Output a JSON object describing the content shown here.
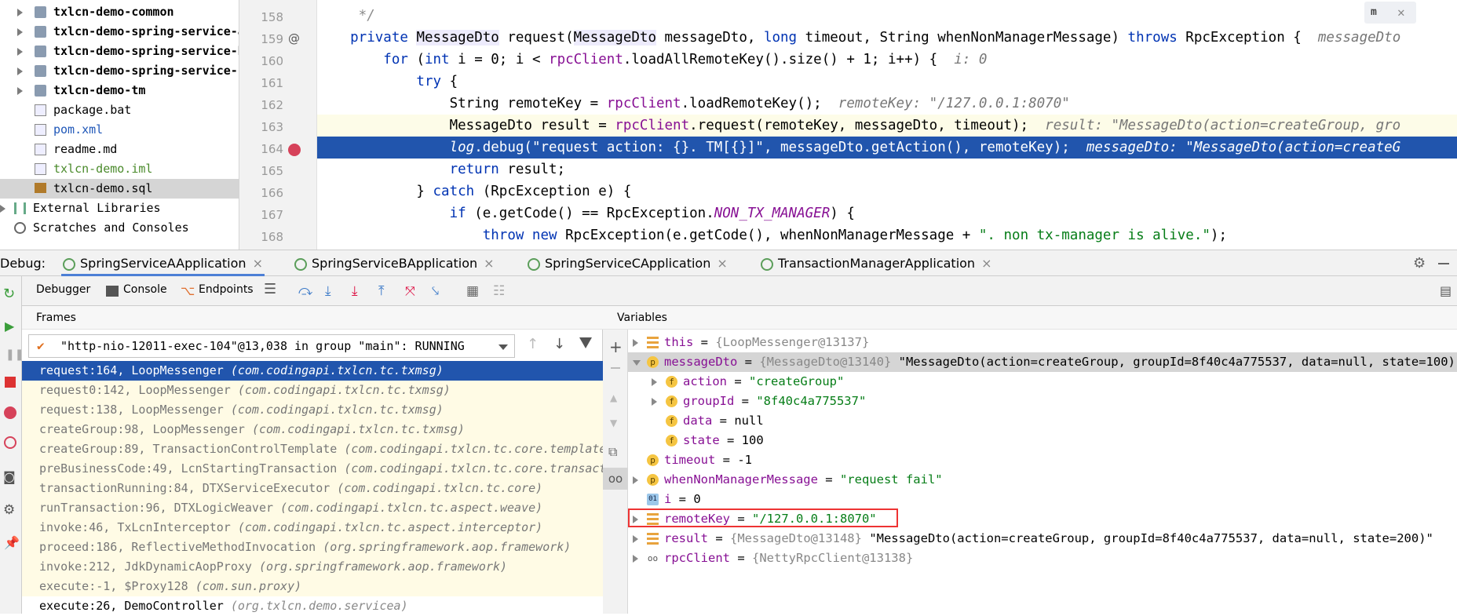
{
  "project_tree": [
    {
      "label": "txlcn-demo-common",
      "bold": true,
      "arrow": true,
      "icon": "folder-icon"
    },
    {
      "label": "txlcn-demo-spring-service-a",
      "bold": true,
      "arrow": true,
      "icon": "folder-icon"
    },
    {
      "label": "txlcn-demo-spring-service-b",
      "bold": true,
      "arrow": true,
      "icon": "folder-icon"
    },
    {
      "label": "txlcn-demo-spring-service-c",
      "bold": true,
      "arrow": true,
      "icon": "folder-icon"
    },
    {
      "label": "txlcn-demo-tm",
      "bold": true,
      "arrow": true,
      "icon": "folder-icon"
    },
    {
      "label": "package.bat",
      "icon": "file-icon"
    },
    {
      "label": "pom.xml",
      "icon": "maven-icon",
      "color": "#1f57b8"
    },
    {
      "label": "readme.md",
      "icon": "markdown-icon"
    },
    {
      "label": "txlcn-demo.iml",
      "icon": "iml-icon",
      "color": "#4a8a2b"
    },
    {
      "label": "txlcn-demo.sql",
      "icon": "sql-icon",
      "selected": true
    },
    {
      "label": "External Libraries",
      "icon": "library-icon",
      "arrow": true,
      "root": true
    },
    {
      "label": "Scratches and Consoles",
      "icon": "scratch-icon",
      "root": true
    }
  ],
  "line_numbers": [
    "158",
    "159",
    "160",
    "161",
    "162",
    "163",
    "164",
    "165",
    "166",
    "167",
    "168"
  ],
  "code": {
    "l158": "     */",
    "l159a": "    private ",
    "l159b": "MessageDto",
    "l159c": " request(",
    "l159d": "MessageDto",
    "l159e": " messageDto, ",
    "l159f": "long",
    "l159g": " timeout, String whenNonManagerMessage) ",
    "l159h": "throws",
    "l159i": " RpcException {  ",
    "l159j": "messageDto",
    "l160a": "        for",
    "l160b": " (",
    "l160c": "int",
    "l160d": " i = 0; i < ",
    "l160e": "rpcClient",
    "l160f": ".loadAllRemoteKey().size() + 1; i++) {  ",
    "l160g": "i: 0",
    "l161a": "            try",
    "l161b": " {",
    "l162a": "                String remoteKey = ",
    "l162b": "rpcClient",
    "l162c": ".loadRemoteKey();  ",
    "l162d": "remoteKey: \"/127.0.0.1:8070\"",
    "l163a": "                MessageDto result = ",
    "l163b": "rpcClient",
    "l163c": ".request(remoteKey, messageDto, timeout);  ",
    "l163d": "result: \"MessageDto(action=createGroup, gro",
    "l164a": "                log",
    "l164b": ".debug(\"request action: {}. TM[{}]\", messageDto.getAction(), remoteKey);  ",
    "l164c": "messageDto: \"MessageDto(action=createG",
    "l165a": "                return",
    "l165b": " result;",
    "l166a": "            } ",
    "l166b": "catch",
    "l166c": " (RpcException e) {",
    "l167a": "                if",
    "l167b": " (e.getCode() == RpcException.",
    "l167c": "NON_TX_MANAGER",
    "l167d": ") {",
    "l168a": "                    throw new",
    "l168b": " RpcException(e.getCode(), whenNonManagerMessage + ",
    "l168c": "\". non tx-manager is alive.\"",
    "l168d": ");"
  },
  "debug_label": "Debug:",
  "debug_tabs": [
    "SpringServiceAApplication",
    "SpringServiceBApplication",
    "SpringServiceCApplication",
    "TransactionManagerApplication"
  ],
  "toolbar": {
    "debugger": "Debugger",
    "console": "Console",
    "endpoints": "Endpoints"
  },
  "frames_header": "Frames",
  "variables_header": "Variables",
  "thread": "\"http-nio-12011-exec-104\"@13,038 in group \"main\": RUNNING",
  "frames": [
    {
      "m": "request:164, LoopMessenger ",
      "p": "(com.codingapi.txlcn.tc.txmsg)",
      "sel": true
    },
    {
      "m": "request0:142, LoopMessenger ",
      "p": "(com.codingapi.txlcn.tc.txmsg)"
    },
    {
      "m": "request:138, LoopMessenger ",
      "p": "(com.codingapi.txlcn.tc.txmsg)"
    },
    {
      "m": "createGroup:98, LoopMessenger ",
      "p": "(com.codingapi.txlcn.tc.txmsg)"
    },
    {
      "m": "createGroup:89, TransactionControlTemplate ",
      "p": "(com.codingapi.txlcn.tc.core.template"
    },
    {
      "m": "preBusinessCode:49, LcnStartingTransaction ",
      "p": "(com.codingapi.txlcn.tc.core.transact"
    },
    {
      "m": "transactionRunning:84, DTXServiceExecutor ",
      "p": "(com.codingapi.txlcn.tc.core)"
    },
    {
      "m": "runTransaction:96, DTXLogicWeaver ",
      "p": "(com.codingapi.txlcn.tc.aspect.weave)"
    },
    {
      "m": "invoke:46, TxLcnInterceptor ",
      "p": "(com.codingapi.txlcn.tc.aspect.interceptor)"
    },
    {
      "m": "proceed:186, ReflectiveMethodInvocation ",
      "p": "(org.springframework.aop.framework)"
    },
    {
      "m": "invoke:212, JdkDynamicAopProxy ",
      "p": "(org.springframework.aop.framework)"
    },
    {
      "m": "execute:-1, $Proxy128 ",
      "p": "(com.sun.proxy)"
    },
    {
      "m": "execute:26, DemoController ",
      "p": "(org.txlcn.demo.servicea)",
      "plain": true
    }
  ],
  "variables": [
    {
      "name": "this",
      "eq": " = ",
      "gray": "{LoopMessenger@13137}",
      "val": "",
      "indent": 0,
      "tri": "right",
      "badge": "bars"
    },
    {
      "name": "messageDto",
      "eq": " = ",
      "gray": "{MessageDto@13140} ",
      "val": "\"MessageDto(action=createGroup, groupId=8f40c4a775537, data=null, state=100)\"",
      "indent": 0,
      "tri": "down",
      "badge": "p",
      "sel": true
    },
    {
      "name": "action",
      "eq": " = ",
      "gray": "",
      "val": "\"createGroup\"",
      "indent": 1,
      "tri": "right",
      "badge": "f",
      "str": true
    },
    {
      "name": "groupId",
      "eq": " = ",
      "gray": "",
      "val": "\"8f40c4a775537\"",
      "indent": 1,
      "tri": "right",
      "badge": "f",
      "str": true
    },
    {
      "name": "data",
      "eq": " = ",
      "gray": "",
      "val": "null",
      "indent": 1,
      "badge": "f"
    },
    {
      "name": "state",
      "eq": " = ",
      "gray": "",
      "val": "100",
      "indent": 1,
      "badge": "f"
    },
    {
      "name": "timeout",
      "eq": " = ",
      "gray": "",
      "val": "-1",
      "indent": 0,
      "badge": "p"
    },
    {
      "name": "whenNonManagerMessage",
      "eq": " = ",
      "gray": "",
      "val": "\"request fail\"",
      "indent": 0,
      "tri": "right",
      "badge": "p",
      "str": true
    },
    {
      "name": "i",
      "eq": " = ",
      "gray": "",
      "val": "0",
      "indent": 0,
      "badge": "01"
    },
    {
      "name": "remoteKey",
      "eq": " = ",
      "gray": "",
      "val": "\"/127.0.0.1:8070\"",
      "indent": 0,
      "tri": "right",
      "badge": "bars",
      "str": true
    },
    {
      "name": "result",
      "eq": " = ",
      "gray": "{MessageDto@13148} ",
      "val": "\"MessageDto(action=createGroup, groupId=8f40c4a775537, data=null, state=200)\"",
      "indent": 0,
      "tri": "right",
      "badge": "bars"
    },
    {
      "name": "rpcClient",
      "eq": " = ",
      "gray": "{NettyRpcClient@13138}",
      "val": "",
      "indent": 0,
      "tri": "right",
      "badge": "oo"
    }
  ],
  "colors": {
    "selection": "#2155ad",
    "frames_bg": "#fffbe5",
    "accent_red": "#e33"
  }
}
